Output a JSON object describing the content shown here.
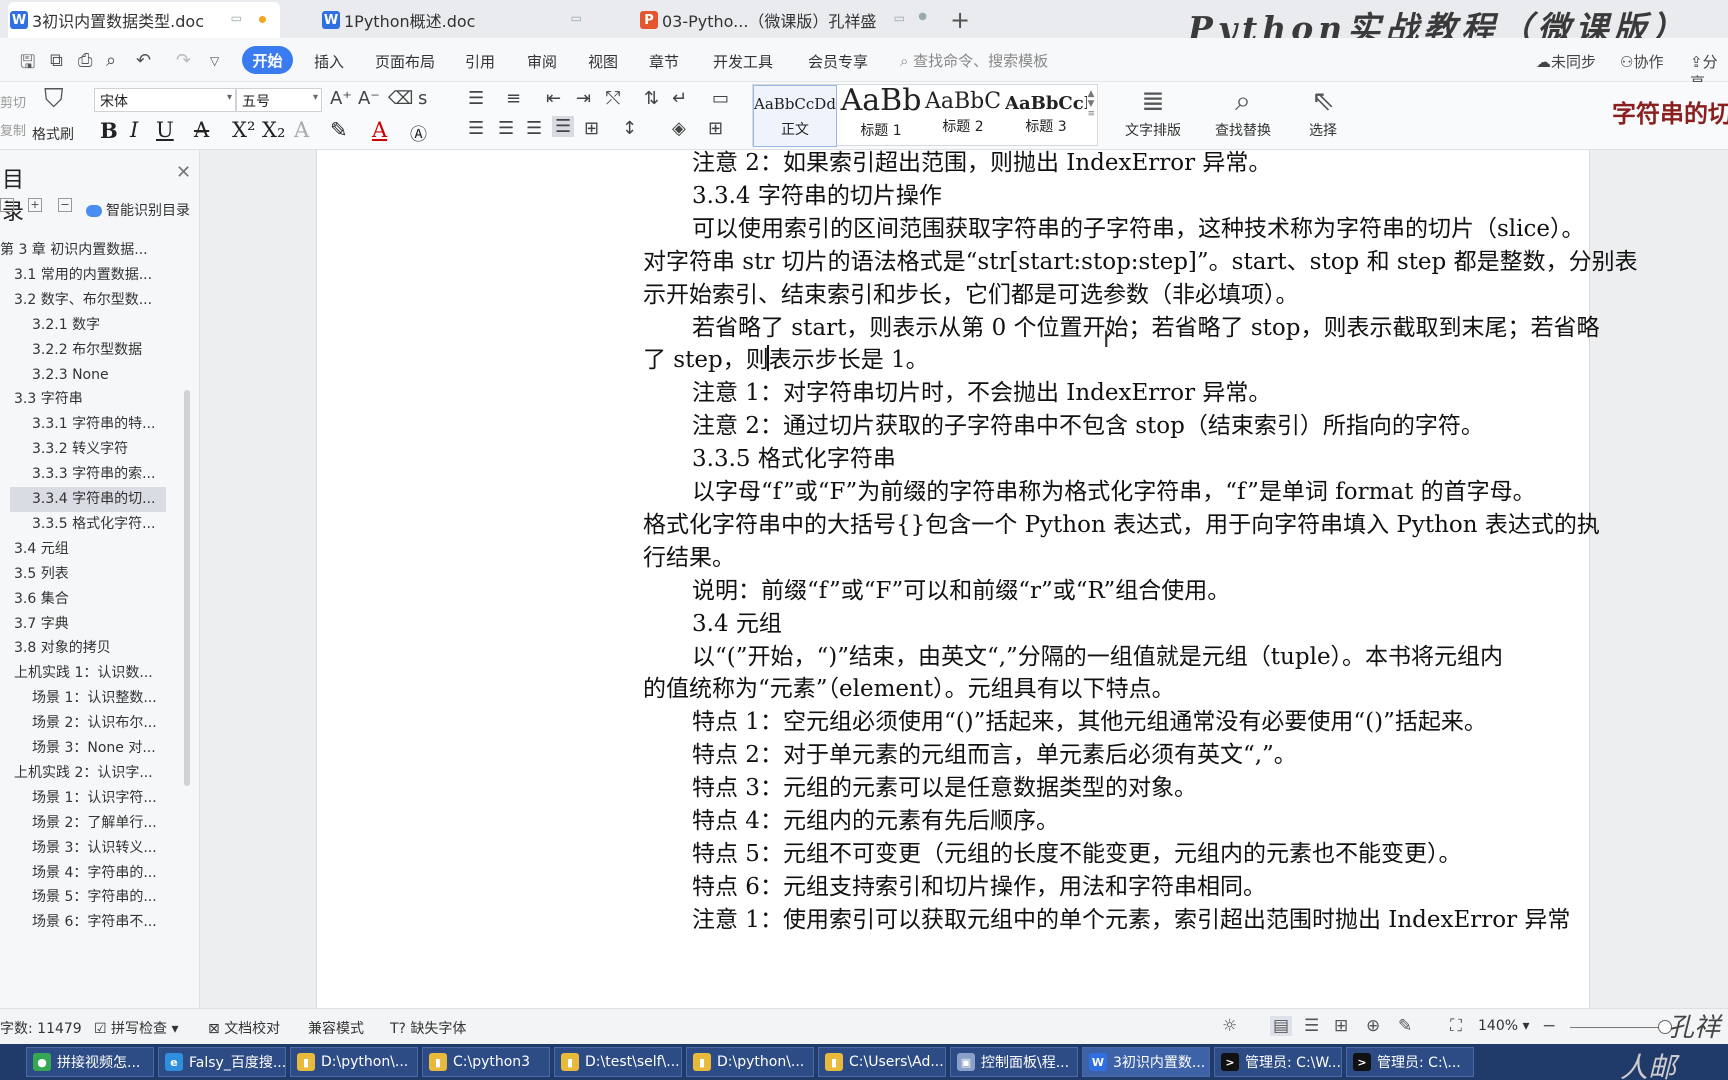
{
  "tabs": [
    {
      "label": "3初识内置数据类型.doc",
      "icon_color": "#2f6fe0",
      "icon": "W",
      "active": true
    },
    {
      "label": "1Python概述.doc",
      "icon_color": "#2f6fe0",
      "icon": "W",
      "active": false
    },
    {
      "label": "03-Pytho...（微课版）孔祥盛",
      "icon_color": "#e4572e",
      "icon": "P",
      "active": false
    }
  ],
  "banner": "Python实战教程（微课版）",
  "menu": {
    "start": "开始",
    "items": [
      "插入",
      "页面布局",
      "引用",
      "审阅",
      "视图",
      "章节",
      "开发工具",
      "会员专享"
    ],
    "search": "查找命令、搜索模板",
    "unsync": "未同步",
    "collab": "协作",
    "share": "分享"
  },
  "ribbon": {
    "cut": "剪切",
    "copy": "复制",
    "format_painter": "格式刷",
    "font_name": "宋体",
    "font_size": "五号",
    "styles": [
      {
        "preview": "AaBbCcDd",
        "label": "正文"
      },
      {
        "preview": "AaBb",
        "label": "标题 1"
      },
      {
        "preview": "AaBbC",
        "label": "标题 2"
      },
      {
        "preview": "AaBbCcI",
        "label": "标题 3"
      }
    ],
    "text_layout": "文字排版",
    "find_replace": "查找替换",
    "select": "选择",
    "handwrite": "字符串的切"
  },
  "toc": {
    "title": "目录",
    "smart": "智能识别目录",
    "items": [
      {
        "label": "第 3 章   初识内置数据...",
        "level": 0,
        "active": false
      },
      {
        "label": "3.1   常用的内置数据...",
        "level": 1,
        "active": false
      },
      {
        "label": "3.2   数字、布尔型数...",
        "level": 1,
        "active": false
      },
      {
        "label": "3.2.1   数字",
        "level": 2,
        "active": false
      },
      {
        "label": "3.2.2   布尔型数据",
        "level": 2,
        "active": false
      },
      {
        "label": "3.2.3   None",
        "level": 2,
        "active": false
      },
      {
        "label": "3.3   字符串",
        "level": 1,
        "active": false
      },
      {
        "label": "3.3.1   字符串的特...",
        "level": 2,
        "active": false
      },
      {
        "label": "3.3.2   转义字符",
        "level": 2,
        "active": false
      },
      {
        "label": "3.3.3   字符串的索...",
        "level": 2,
        "active": false
      },
      {
        "label": "3.3.4   字符串的切...",
        "level": 2,
        "active": true
      },
      {
        "label": "3.3.5   格式化字符...",
        "level": 2,
        "active": false
      },
      {
        "label": "3.4   元组",
        "level": 1,
        "active": false
      },
      {
        "label": "3.5   列表",
        "level": 1,
        "active": false
      },
      {
        "label": "3.6   集合",
        "level": 1,
        "active": false
      },
      {
        "label": "3.7   字典",
        "level": 1,
        "active": false
      },
      {
        "label": "3.8   对象的拷贝",
        "level": 1,
        "active": false
      },
      {
        "label": "上机实践 1：认识数...",
        "level": 1,
        "active": false
      },
      {
        "label": "场景 1：认识整数...",
        "level": 2,
        "active": false
      },
      {
        "label": "场景 2：认识布尔...",
        "level": 2,
        "active": false
      },
      {
        "label": "场景 3：None 对...",
        "level": 2,
        "active": false
      },
      {
        "label": "上机实践 2：认识字...",
        "level": 1,
        "active": false
      },
      {
        "label": "场景 1：认识字符...",
        "level": 2,
        "active": false
      },
      {
        "label": "场景 2：了解单行...",
        "level": 2,
        "active": false
      },
      {
        "label": "场景 3：认识转义...",
        "level": 2,
        "active": false
      },
      {
        "label": "场景 4：字符串的...",
        "level": 2,
        "active": false
      },
      {
        "label": "场景 5：字符串的...",
        "level": 2,
        "active": false
      },
      {
        "label": "场景 6：字符串不...",
        "level": 2,
        "active": false
      }
    ]
  },
  "document": {
    "lines": [
      {
        "text": "注意 2：如果索引超出范围，则抛出 IndexError 异常。",
        "type": "para"
      },
      {
        "text": "3.3.4    字符串的切片操作",
        "type": "head"
      },
      {
        "text": "可以使用索引的区间范围获取字符串的子字符串，这种技术称为字符串的切片（slice）。",
        "type": "para"
      },
      {
        "text": "对字符串 str 切片的语法格式是“str[start:stop:step]”。start、stop 和 step 都是整数，分别表",
        "type": "cont"
      },
      {
        "text": "示开始索引、结束索引和步长，它们都是可选参数（非必填项）。",
        "type": "cont"
      },
      {
        "text": "若省略了 start，则表示从第 0 个位置开始；若省略了 stop，则表示截取到末尾；若省略",
        "type": "para"
      },
      {
        "text": "了 step，则表示步长是 1。",
        "type": "cont"
      },
      {
        "text": "注意 1：对字符串切片时，不会抛出 IndexError 异常。",
        "type": "para"
      },
      {
        "text": "注意 2：通过切片获取的子字符串中不包含 stop（结束索引）所指向的字符。",
        "type": "para"
      },
      {
        "text": "3.3.5    格式化字符串",
        "type": "head"
      },
      {
        "text": "以字母“f”或“F”为前缀的字符串称为格式化字符串，“f”是单词 format 的首字母。",
        "type": "para"
      },
      {
        "text": "格式化字符串中的大括号{}包含一个 Python 表达式，用于向字符串填入 Python 表达式的执",
        "type": "cont"
      },
      {
        "text": "行结果。",
        "type": "cont"
      },
      {
        "text": "说明：前缀“f”或“F”可以和前缀“r”或“R”组合使用。",
        "type": "para"
      },
      {
        "text": "3.4    元组",
        "type": "head"
      },
      {
        "text": "以“(”开始，“)”结束，由英文“,”分隔的一组值就是元组（tuple）。本书将元组内",
        "type": "para"
      },
      {
        "text": "的值统称为“元素”（element）。元组具有以下特点。",
        "type": "cont"
      },
      {
        "text": "特点 1：空元组必须使用“()”括起来，其他元组通常没有必要使用“()”括起来。",
        "type": "para"
      },
      {
        "text": "特点 2：对于单元素的元组而言，单元素后必须有英文“,”。",
        "type": "para"
      },
      {
        "text": "特点 3：元组的元素可以是任意数据类型的对象。",
        "type": "para"
      },
      {
        "text": "特点 4：元组内的元素有先后顺序。",
        "type": "para"
      },
      {
        "text": "特点 5：元组不可变更（元组的长度不能变更，元组内的元素也不能变更）。",
        "type": "para"
      },
      {
        "text": "特点 6：元组支持索引和切片操作，用法和字符串相同。",
        "type": "para"
      },
      {
        "text": "注意 1：使用索引可以获取元组中的单个元素，索引超出范围时抛出 IndexError 异常",
        "type": "para"
      }
    ]
  },
  "status": {
    "word_count": "字数: 11479",
    "spell": "拼写检查",
    "proof": "文档校对",
    "compat": "兼容模式",
    "missing_font": "缺失字体",
    "zoom": "140%",
    "handwrite": "孔祥"
  },
  "taskbar": [
    {
      "label": "拼接视频怎...",
      "color": "#34a853",
      "icon": "●"
    },
    {
      "label": "Falsy_百度搜...",
      "color": "#2f8fdd",
      "icon": "e"
    },
    {
      "label": "D:\\python\\...",
      "color": "#e8b93a",
      "icon": "▮"
    },
    {
      "label": "C:\\python3",
      "color": "#e8b93a",
      "icon": "▮"
    },
    {
      "label": "D:\\test\\self\\...",
      "color": "#e8b93a",
      "icon": "▮"
    },
    {
      "label": "D:\\python\\...",
      "color": "#e8b93a",
      "icon": "▮"
    },
    {
      "label": "C:\\Users\\Ad...",
      "color": "#e8b93a",
      "icon": "▮"
    },
    {
      "label": "控制面板\\程...",
      "color": "#8aa0c8",
      "icon": "▣"
    },
    {
      "label": "3初识内置数...",
      "color": "#2f6fe0",
      "icon": "W"
    },
    {
      "label": "管理员: C:\\W...",
      "color": "#111",
      "icon": ">"
    },
    {
      "label": "管理员: C:\\...",
      "color": "#111",
      "icon": ">"
    }
  ],
  "taskbar_handwrite": "人邮"
}
